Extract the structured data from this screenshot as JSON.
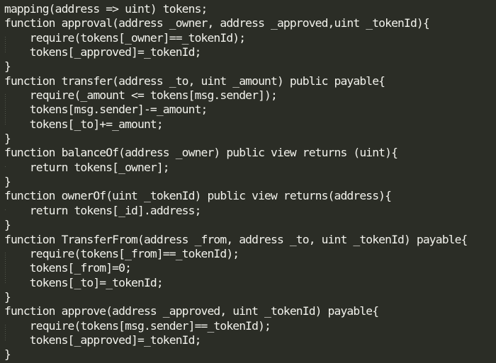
{
  "editor": {
    "language": "solidity",
    "background_color": "#2b2d26",
    "text_color": "#f2f2ec",
    "indent_guide_color": "#555a4e",
    "font_size_px": 16,
    "line_height_px": 20,
    "total_lines": 25,
    "lines": [
      {
        "n": 1,
        "text": "mapping(address => uint) tokens;",
        "indent": 0,
        "guide": false
      },
      {
        "n": 2,
        "text": "function approval(address _owner, address _approved,uint _tokenId){",
        "indent": 0,
        "guide": false
      },
      {
        "n": 3,
        "text": "    require(tokens[_owner]==_tokenId);",
        "indent": 1,
        "guide": true
      },
      {
        "n": 4,
        "text": "    tokens[_approved]=_tokenId;",
        "indent": 1,
        "guide": true
      },
      {
        "n": 5,
        "text": "}",
        "indent": 0,
        "guide": false
      },
      {
        "n": 6,
        "text": "function transfer(address _to, uint _amount) public payable{",
        "indent": 0,
        "guide": false
      },
      {
        "n": 7,
        "text": "    require(_amount <= tokens[msg.sender]);",
        "indent": 1,
        "guide": true
      },
      {
        "n": 8,
        "text": "    tokens[msg.sender]-=_amount;",
        "indent": 1,
        "guide": true
      },
      {
        "n": 9,
        "text": "    tokens[_to]+=_amount;",
        "indent": 1,
        "guide": true
      },
      {
        "n": 10,
        "text": "}",
        "indent": 0,
        "guide": false
      },
      {
        "n": 11,
        "text": "function balanceOf(address _owner) public view returns (uint){",
        "indent": 0,
        "guide": false
      },
      {
        "n": 12,
        "text": "    return tokens[_owner];",
        "indent": 1,
        "guide": true
      },
      {
        "n": 13,
        "text": "}",
        "indent": 0,
        "guide": false
      },
      {
        "n": 14,
        "text": "function ownerOf(uint _tokenId) public view returns(address){",
        "indent": 0,
        "guide": false
      },
      {
        "n": 15,
        "text": "    return tokens[_id].address;",
        "indent": 1,
        "guide": true
      },
      {
        "n": 16,
        "text": "}",
        "indent": 0,
        "guide": false
      },
      {
        "n": 17,
        "text": "function TransferFrom(address _from, address _to, uint _tokenId) payable{",
        "indent": 0,
        "guide": false
      },
      {
        "n": 18,
        "text": "    require(tokens[_from]==_tokenId);",
        "indent": 1,
        "guide": true
      },
      {
        "n": 19,
        "text": "    tokens[_from]=0;",
        "indent": 1,
        "guide": true
      },
      {
        "n": 20,
        "text": "    tokens[_to]=_tokenId;",
        "indent": 1,
        "guide": true
      },
      {
        "n": 21,
        "text": "}",
        "indent": 0,
        "guide": false
      },
      {
        "n": 22,
        "text": "function approve(address _approved, uint _tokenId) payable{",
        "indent": 0,
        "guide": false
      },
      {
        "n": 23,
        "text": "    require(tokens[msg.sender]==_tokenId);",
        "indent": 1,
        "guide": true
      },
      {
        "n": 24,
        "text": "    tokens[_approved]=_tokenId;",
        "indent": 1,
        "guide": true
      },
      {
        "n": 25,
        "text": "}",
        "indent": 0,
        "guide": false
      }
    ]
  }
}
